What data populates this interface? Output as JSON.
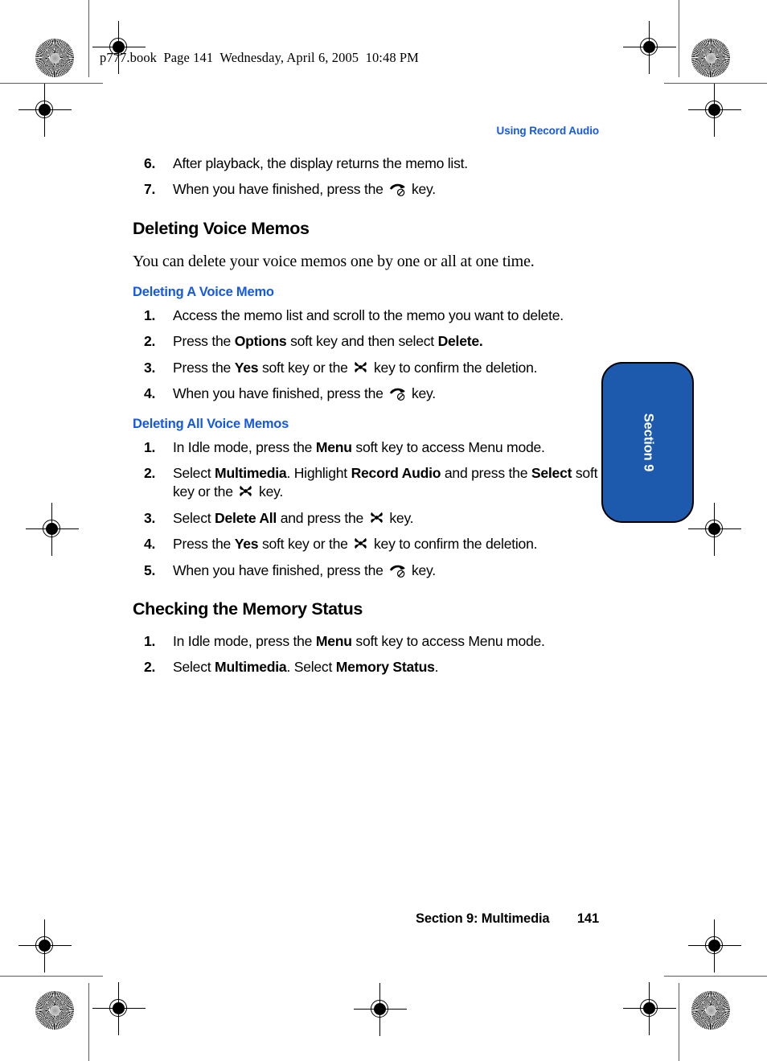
{
  "print_header": "p777.book  Page 141  Wednesday, April 6, 2005  10:48 PM",
  "running_head": "Using Record Audio",
  "colors": {
    "heading_blue": "#1559e0",
    "tab_blue": "#1d5aad",
    "text_black": "#000000"
  },
  "top_steps": [
    {
      "num": "6.",
      "html": "After playback, the display returns the memo list."
    },
    {
      "num": "7.",
      "html": "When you have finished, press the <ico>endcall</ico> key."
    }
  ],
  "section_heading": "Deleting Voice Memos",
  "intro_paragraph": "You can delete your voice memos one by one or all at one time.",
  "sub_sections": [
    {
      "heading": "Deleting A Voice Memo",
      "steps": [
        {
          "num": "1.",
          "html": "Access the memo list and scroll to the memo you want to delete."
        },
        {
          "num": "2.",
          "html": "Press the <b>Options</b> soft key and then select <b>Delete.</b>"
        },
        {
          "num": "3.",
          "html": "Press the <b>Yes</b> soft key or the <ico>okkey</ico> key to confirm the deletion."
        },
        {
          "num": "4.",
          "html": "When you have finished, press the <ico>endcall</ico> key."
        }
      ]
    },
    {
      "heading": "Deleting All Voice Memos",
      "steps": [
        {
          "num": "1.",
          "html": "In Idle mode, press the <b>Menu</b> soft key to access Menu mode."
        },
        {
          "num": "2.",
          "html": "Select <b>Multimedia</b>. Highlight <b>Record Audio</b> and press the <b>Select</b> soft key or the <ico>okkey</ico> key."
        },
        {
          "num": "3.",
          "html": "Select <b>Delete All</b> and press the <ico>okkey</ico> key."
        },
        {
          "num": "4.",
          "html": "Press the <b>Yes</b> soft key or the <ico>okkey</ico> key to confirm the deletion."
        },
        {
          "num": "5.",
          "html": "When you have finished, press the <ico>endcall</ico> key."
        }
      ]
    }
  ],
  "section_heading_2": "Checking the Memory Status",
  "memory_steps": [
    {
      "num": "1.",
      "html": "In Idle mode, press the <b>Menu</b> soft key to access Menu mode."
    },
    {
      "num": "2.",
      "html": "Select <b>Multimedia</b>. Select <b>Memory Status</b>."
    }
  ],
  "section_tab_label": "Section 9",
  "footer": {
    "section_title": "Section 9: Multimedia",
    "page_number": "141"
  },
  "icons": {
    "endcall": "end-call-key-icon",
    "okkey": "ok-select-key-icon"
  }
}
